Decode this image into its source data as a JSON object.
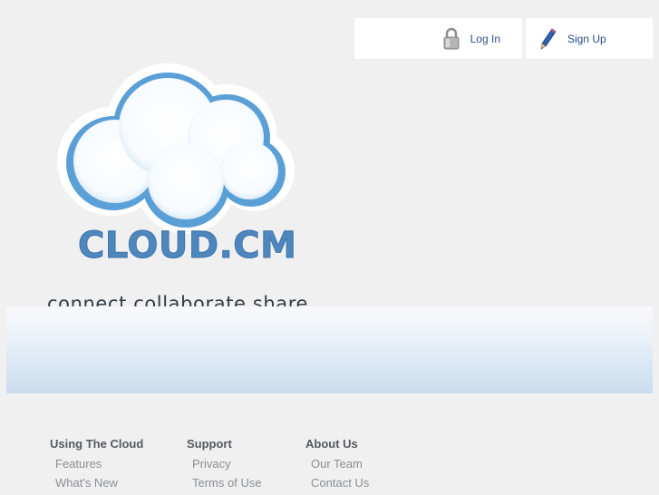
{
  "header": {
    "login_label": "Log In",
    "signup_label": "Sign Up",
    "login_icon": "padlock-icon",
    "signup_icon": "pencil-icon"
  },
  "brand": {
    "name": "CLOUD.CM",
    "tagline": "connect.collaborate.share",
    "logo_icon": "cloud-icon",
    "accent_color": "#4e86be"
  },
  "footer": {
    "columns": [
      {
        "heading": "Using The Cloud",
        "links": [
          "Features",
          "What's New"
        ]
      },
      {
        "heading": "Support",
        "links": [
          "Privacy",
          "Terms of Use"
        ]
      },
      {
        "heading": "About Us",
        "links": [
          "Our Team",
          "Contact Us"
        ]
      }
    ]
  }
}
